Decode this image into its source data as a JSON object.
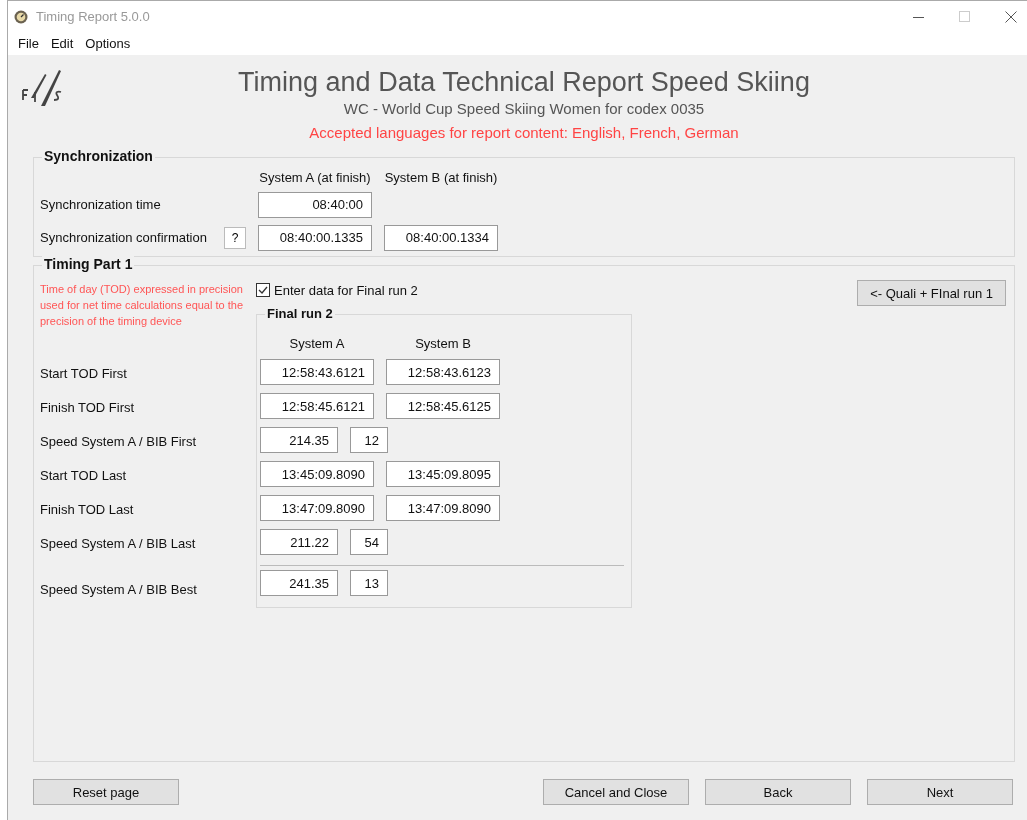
{
  "window": {
    "title": "Timing Report 5.0.0"
  },
  "menu": [
    "File",
    "Edit",
    "Options"
  ],
  "header": {
    "title": "Timing and Data Technical Report Speed Skiing",
    "subtitle": "WC - World Cup Speed Skiing Women for codex 0035",
    "languages_note": "Accepted languages for report content: English, French, German"
  },
  "synchronization": {
    "legend": "Synchronization",
    "columns": [
      "System A (at finish)",
      "System B (at finish)"
    ],
    "rows": [
      {
        "label": "Synchronization time",
        "values": [
          "08:40:00"
        ]
      },
      {
        "label": "Synchronization confirmation",
        "help": "?",
        "values": [
          "08:40:00.1335",
          "08:40:00.1334"
        ]
      }
    ]
  },
  "timing_part_1": {
    "legend": "Timing Part 1",
    "note": "Time of day (TOD) expressed in precision used for net time calculations equal to the precision of the timing device",
    "checkbox": {
      "label": "Enter data for Final run 2",
      "checked": true
    },
    "side_button": "<- Quali + FInal run 1",
    "final_run": {
      "legend": "Final run 2",
      "columns": [
        "System A",
        "System B"
      ],
      "rows": [
        {
          "kind": "times",
          "label": "Start TOD First",
          "divider_before": false,
          "values": [
            "12:58:43.6121",
            "12:58:43.6123"
          ]
        },
        {
          "kind": "times",
          "label": "Finish TOD First",
          "divider_before": false,
          "values": [
            "12:58:45.6121",
            "12:58:45.6125"
          ]
        },
        {
          "kind": "speed",
          "label": "Speed System A / BIB First",
          "divider_before": false,
          "values": [
            "214.35",
            "12"
          ]
        },
        {
          "kind": "times",
          "label": "Start TOD Last",
          "divider_before": false,
          "values": [
            "13:45:09.8090",
            "13:45:09.8095"
          ]
        },
        {
          "kind": "times",
          "label": "Finish TOD Last",
          "divider_before": false,
          "values": [
            "13:47:09.8090",
            "13:47:09.8090"
          ]
        },
        {
          "kind": "speed",
          "label": "Speed System A / BIB Last",
          "divider_before": false,
          "values": [
            "211.22",
            "54"
          ]
        },
        {
          "kind": "speed",
          "label": "Speed System A / BIB Best",
          "divider_before": true,
          "values": [
            "241.35",
            "13"
          ]
        }
      ]
    }
  },
  "footer": {
    "left": [
      "Reset page"
    ],
    "right": [
      "Cancel and Close",
      "Back",
      "Next"
    ]
  }
}
